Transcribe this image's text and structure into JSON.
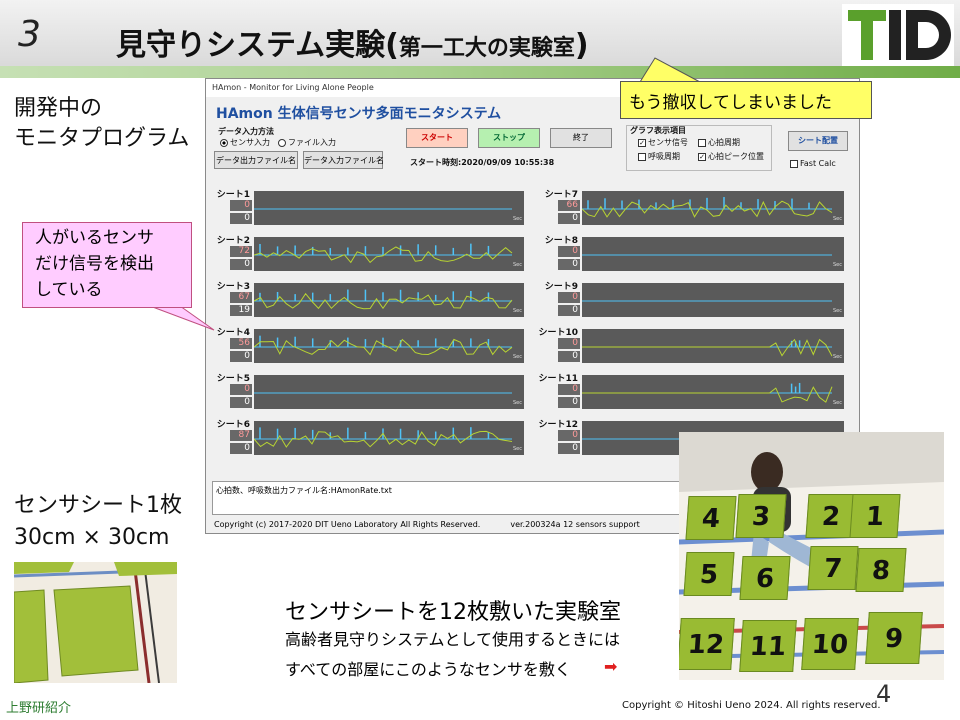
{
  "slide": {
    "number": "3",
    "title_main": "見守りシステム実験(",
    "title_sub": "第一工大の実験室",
    "title_close": ")",
    "logo_text": "TID",
    "left_label_1": "開発中の",
    "left_label_2": "モニタプログラム",
    "callout_top": "もう撤収してしまいました",
    "callout_left_1": "人がいるセンサ",
    "callout_left_2": "だけ信号を検出",
    "callout_left_3": "している",
    "sheet_label_1": "センサシート1枚",
    "sheet_label_2": "30cm × 30cm",
    "experiment_title": "センサシートを12枚敷いた実験室",
    "experiment_sub_1": "高齢者見守りシステムとして使用するときには",
    "experiment_sub_2": "すべての部屋にこのようなセンサを敷く",
    "footer_left": "上野研紹介",
    "copyright": "Copyright © Hitoshi Ueno  2024. All rights reserved.",
    "page_number": "4"
  },
  "app": {
    "window_title": "HAmon - Monitor for Living Alone People",
    "heading": "HAmon 生体信号センサ多面モニタシステム",
    "input_method_label": "データ入力方法",
    "radio_sensor": "センサ入力",
    "radio_file": "ファイル入力",
    "btn_output_file": "データ出力ファイル名",
    "btn_input_file": "データ入力ファイル名",
    "btn_start": "スタート",
    "btn_stop": "ストップ",
    "btn_exit": "終了",
    "start_time": "スタート時刻:2020/09/09 10:55:38",
    "graph_items_label": "グラフ表示項目",
    "chk_sensor": "センサ信号",
    "chk_heart_cycle": "心拍周期",
    "chk_resp_cycle": "呼吸周期",
    "chk_heart_peak": "心拍ピーク位置",
    "btn_sheet_layout": "シート配置",
    "chk_fast_calc": "Fast Calc",
    "sec_label": "Sec",
    "sheets": [
      {
        "label": "シート1",
        "hr": "0",
        "rr": "0"
      },
      {
        "label": "シート2",
        "hr": "72",
        "rr": "0"
      },
      {
        "label": "シート3",
        "hr": "67",
        "rr": "19"
      },
      {
        "label": "シート4",
        "hr": "56",
        "rr": "0"
      },
      {
        "label": "シート5",
        "hr": "0",
        "rr": "0"
      },
      {
        "label": "シート6",
        "hr": "87",
        "rr": "0"
      },
      {
        "label": "シート7",
        "hr": "66",
        "rr": "0"
      },
      {
        "label": "シート8",
        "hr": "0",
        "rr": "0"
      },
      {
        "label": "シート9",
        "hr": "0",
        "rr": "0"
      },
      {
        "label": "シート10",
        "hr": "0",
        "rr": "0"
      },
      {
        "label": "シート11",
        "hr": "0",
        "rr": "0"
      },
      {
        "label": "シート12",
        "hr": "0",
        "rr": "0"
      }
    ],
    "output_file_text": "心拍数、呼吸数出力ファイル名:HAmonRate.txt",
    "footer_copyright": "Copyright (c) 2017-2020 DIT Ueno Laboratory All Rights Reserved.",
    "footer_version": "ver.200324a  12 sensors support"
  },
  "photo": {
    "pad_numbers": [
      "4",
      "3",
      "2",
      "1",
      "5",
      "6",
      "7",
      "8",
      "12",
      "11",
      "10",
      "9"
    ]
  },
  "colors": {
    "heading_blue": "#1f4fa0",
    "hr_value": "#ff9a9a",
    "rr_value": "#ffffff",
    "signal_blue": "#4fc3f7",
    "signal_green": "#b8d432",
    "start_button": "#ffd0c0",
    "stop_button": "#b6f0b0"
  }
}
